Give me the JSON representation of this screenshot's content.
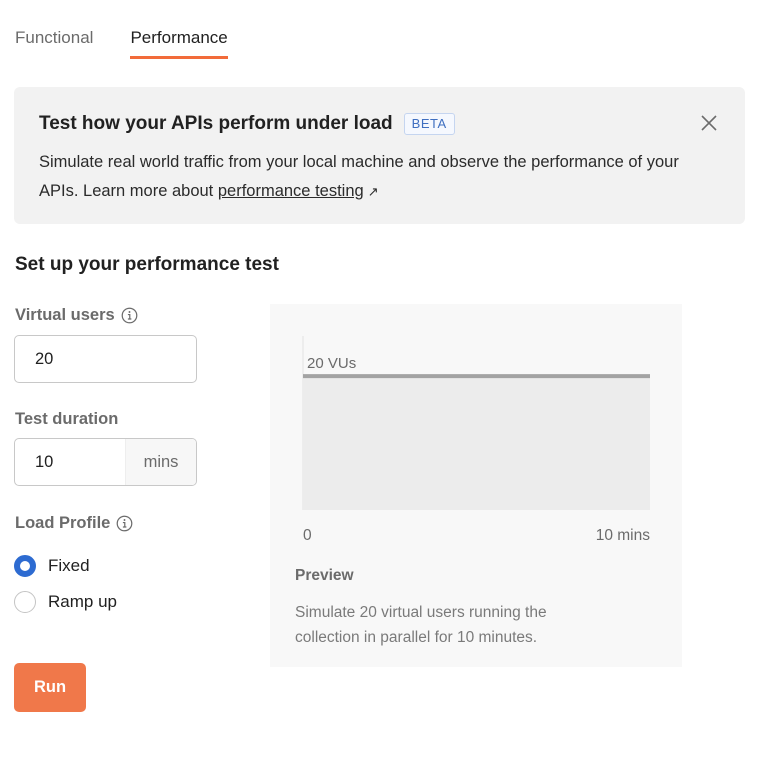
{
  "tabs": [
    {
      "label": "Functional",
      "active": false
    },
    {
      "label": "Performance",
      "active": true
    }
  ],
  "banner": {
    "title": "Test how your APIs perform under load",
    "badge": "BETA",
    "text": "Simulate real world traffic from your local machine and observe the performance of your APIs. Learn more about ",
    "link_label": "performance testing",
    "link_icon": "external-arrow-icon",
    "close_icon": "close-icon"
  },
  "form": {
    "section_title": "Set up your performance test",
    "virtual_users": {
      "label": "Virtual users",
      "value": "20",
      "icon": "info-icon"
    },
    "test_duration": {
      "label": "Test duration",
      "value": "10",
      "suffix": "mins"
    },
    "load_profile": {
      "label": "Load Profile",
      "icon": "info-icon",
      "options": [
        {
          "label": "Fixed",
          "checked": true
        },
        {
          "label": "Ramp up",
          "checked": false
        }
      ]
    },
    "run_label": "Run"
  },
  "preview": {
    "title": "Preview",
    "description": "Simulate 20 virtual users running the collection in parallel for 10 minutes.",
    "chart_data": {
      "type": "area",
      "series": [
        {
          "name": "Virtual users",
          "x": [
            0,
            10
          ],
          "values": [
            20,
            20
          ]
        }
      ],
      "line_label": "20 VUs",
      "x_tick_labels": [
        "0",
        "10 mins"
      ],
      "xlim": [
        0,
        10
      ],
      "ylim": [
        0,
        26
      ],
      "grid": false
    }
  },
  "colors": {
    "accent": "#f26b3a",
    "run_button": "#f0784a",
    "radio_checked": "#2d6bd1",
    "beta_text": "#3f6fc0"
  }
}
